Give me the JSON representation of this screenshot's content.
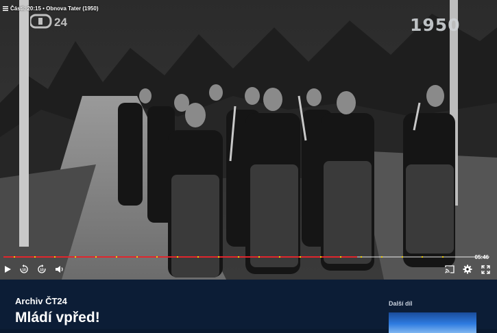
{
  "player": {
    "chapters_label": "Části: 20:15 • Obnova Tater (1950)",
    "channel_logo_text": "ČT24",
    "year_overlay": "1950",
    "time_remaining": "05:46",
    "progress_fraction": 0.728,
    "chapter_marker_fractions": [
      0.021,
      0.063,
      0.105,
      0.147,
      0.189,
      0.231,
      0.273,
      0.315,
      0.357,
      0.399,
      0.441,
      0.483,
      0.525,
      0.567,
      0.609,
      0.651,
      0.693,
      0.735,
      0.777,
      0.819,
      0.861,
      0.903
    ],
    "skip_back_seconds": "10",
    "skip_forward_seconds": "10",
    "accent_color": "#e1262c",
    "marker_color": "#f5d400"
  },
  "info": {
    "series": "Archiv ČT24",
    "title": "Mládí vpřed!",
    "next_label": "Další díl"
  },
  "icons": [
    "list-icon",
    "play-icon",
    "replay-10-icon",
    "forward-10-icon",
    "volume-icon",
    "cast-icon",
    "gear-icon",
    "fullscreen-icon"
  ]
}
